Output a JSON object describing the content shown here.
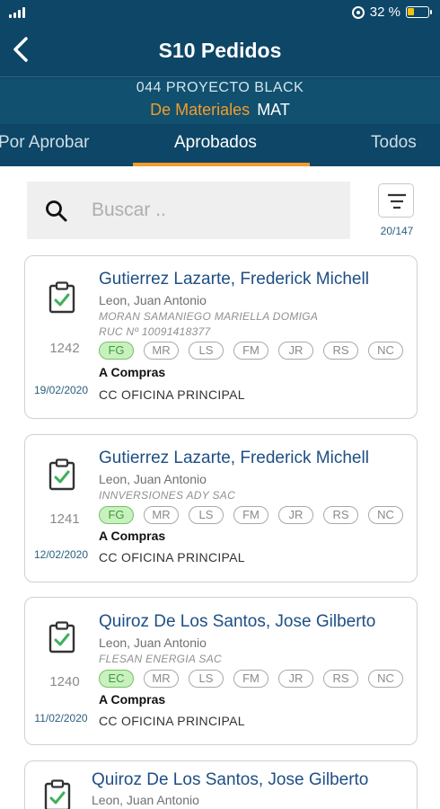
{
  "status": {
    "battery_text": "32 %"
  },
  "header": {
    "title": "S10 Pedidos",
    "project": "044 PROYECTO BLACK",
    "materials_label": "De Materiales",
    "materials_code": "MAT"
  },
  "tabs": [
    {
      "label": "Por Aprobar"
    },
    {
      "label": "Aprobados"
    },
    {
      "label": "Todos"
    }
  ],
  "search": {
    "placeholder": "Buscar .."
  },
  "filter": {
    "count": "20/147"
  },
  "orders": [
    {
      "code": "1242",
      "date": "19/02/2020",
      "name": "Gutierrez Lazarte, Frederick Michell",
      "requester": "Leon, Juan Antonio",
      "provider": "MORAN SAMANIEGO MARIELLA DOMIGA",
      "ruc": "RUC Nº 10091418377",
      "chips": [
        "FG",
        "MR",
        "LS",
        "FM",
        "JR",
        "RS",
        "NC"
      ],
      "stage": "A Compras",
      "cost_center": "CC OFICINA PRINCIPAL"
    },
    {
      "code": "1241",
      "date": "12/02/2020",
      "name": "Gutierrez Lazarte, Frederick Michell",
      "requester": "Leon, Juan Antonio",
      "provider": "INNVERSIONES ADY SAC",
      "chips": [
        "FG",
        "MR",
        "LS",
        "FM",
        "JR",
        "RS",
        "NC"
      ],
      "stage": "A Compras",
      "cost_center": "CC OFICINA PRINCIPAL"
    },
    {
      "code": "1240",
      "date": "11/02/2020",
      "name": "Quiroz De Los Santos, Jose Gilberto",
      "requester": "Leon, Juan Antonio",
      "provider": "FLESAN ENERGIA SAC",
      "chips": [
        "EC",
        "MR",
        "LS",
        "FM",
        "JR",
        "RS",
        "NC"
      ],
      "stage": "A Compras",
      "cost_center": "CC OFICINA PRINCIPAL"
    },
    {
      "name": "Quiroz De Los Santos, Jose Gilberto",
      "requester": "Leon, Juan Antonio"
    }
  ],
  "colors": {
    "header_bg": "#0d4666",
    "accent_orange": "#f39c2b",
    "name_blue": "#1e4f84",
    "chip_active_bg": "#c9f1c0",
    "chip_active_border": "#73c266",
    "check_green": "#3fb05a"
  },
  "icons": {
    "back": "chevron-left-icon",
    "search": "search-icon",
    "filter": "filter-icon",
    "order": "clipboard-check-icon"
  }
}
